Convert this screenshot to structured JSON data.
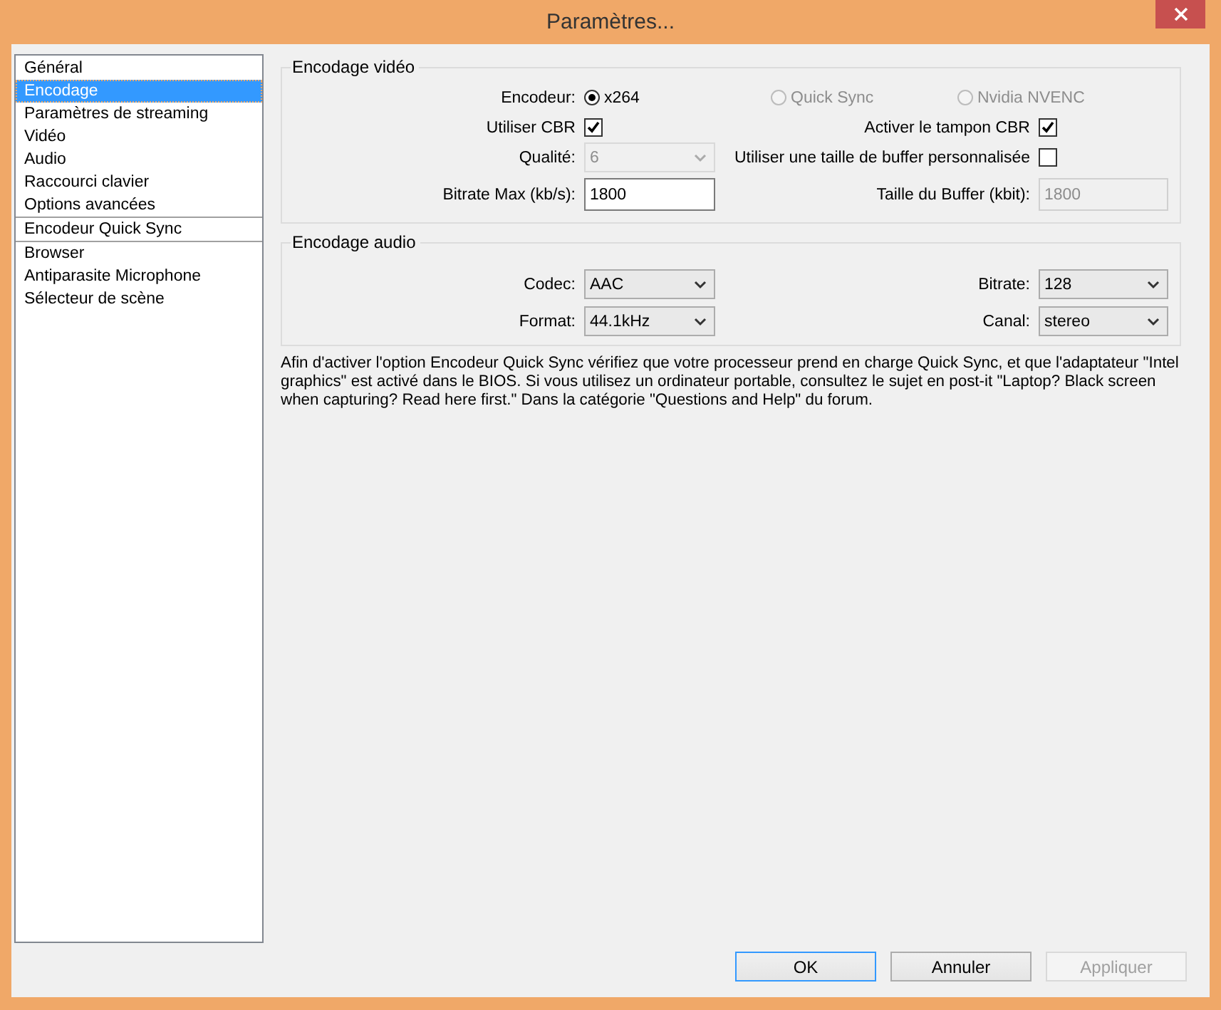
{
  "window": {
    "title": "Paramètres..."
  },
  "sidebar": {
    "groups": [
      [
        {
          "label": "Général",
          "selected": false
        },
        {
          "label": "Encodage",
          "selected": true
        },
        {
          "label": "Paramètres de streaming",
          "selected": false
        },
        {
          "label": "Vidéo",
          "selected": false
        },
        {
          "label": "Audio",
          "selected": false
        },
        {
          "label": "Raccourci clavier",
          "selected": false
        },
        {
          "label": "Options avancées",
          "selected": false
        }
      ],
      [
        {
          "label": "Encodeur Quick Sync",
          "selected": false
        }
      ],
      [
        {
          "label": "Browser",
          "selected": false
        },
        {
          "label": "Antiparasite Microphone",
          "selected": false
        },
        {
          "label": "Sélecteur de scène",
          "selected": false
        }
      ]
    ]
  },
  "video_encoding": {
    "title": "Encodage vidéo",
    "encoder": {
      "label": "Encodeur:",
      "options": [
        {
          "label": "x264",
          "selected": true,
          "disabled": false
        },
        {
          "label": "Quick Sync",
          "selected": false,
          "disabled": true
        },
        {
          "label": "Nvidia NVENC",
          "selected": false,
          "disabled": true
        }
      ]
    },
    "use_cbr": {
      "label": "Utiliser CBR",
      "checked": true
    },
    "cbr_buffer": {
      "label": "Activer le tampon CBR",
      "checked": true
    },
    "quality": {
      "label": "Qualité:",
      "value": "6",
      "disabled": true
    },
    "custom_buffer": {
      "label": "Utiliser une taille de buffer personnalisée",
      "checked": false
    },
    "max_bitrate": {
      "label": "Bitrate Max (kb/s):",
      "value": "1800",
      "disabled": false
    },
    "buffer_size": {
      "label": "Taille du Buffer (kbit):",
      "value": "1800",
      "disabled": true
    }
  },
  "audio_encoding": {
    "title": "Encodage audio",
    "fields": [
      {
        "label": "Codec:",
        "value": "AAC"
      },
      {
        "label": "Bitrate:",
        "value": "128"
      },
      {
        "label": "Format:",
        "value": "44.1kHz"
      },
      {
        "label": "Canal:",
        "value": "stereo"
      }
    ]
  },
  "note": "Afin d'activer l'option Encodeur Quick Sync vérifiez que votre processeur prend en charge Quick Sync, et que l'adaptateur \"Intel graphics\" est activé dans le BIOS. Si vous utilisez un ordinateur portable, consultez le sujet  en post-it \"Laptop? Black screen when capturing? Read here first.\" Dans la catégorie \"Questions and Help\" du forum.",
  "buttons": [
    {
      "label": "OK",
      "disabled": false,
      "default": true
    },
    {
      "label": "Annuler",
      "disabled": false,
      "default": false
    },
    {
      "label": "Appliquer",
      "disabled": true,
      "default": false
    }
  ]
}
